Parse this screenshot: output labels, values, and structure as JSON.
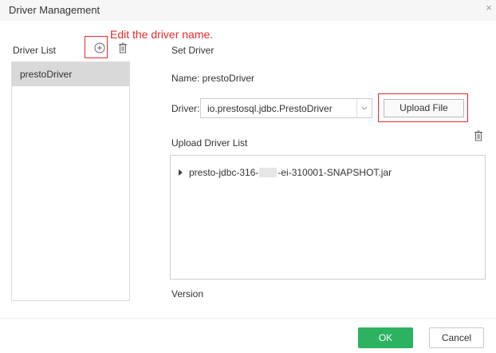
{
  "dialog": {
    "title": "Driver Management",
    "close_glyph": "×"
  },
  "annotation": {
    "text": "Edit the driver name.",
    "color": "#e32b2b"
  },
  "left_panel": {
    "heading": "Driver List",
    "add_icon": "plus-circle-icon",
    "delete_icon": "trash-icon",
    "items": [
      {
        "label": "prestoDriver",
        "selected": true
      }
    ]
  },
  "right_panel": {
    "heading": "Set Driver",
    "name_label": "Name: prestoDriver",
    "driver_label": "Driver:",
    "driver_value": "io.prestosql.jdbc.PrestoDriver",
    "upload_button": "Upload File",
    "upload_list_label": "Upload Driver List",
    "upload_list_delete_icon": "trash-icon",
    "files": [
      {
        "prefix": "presto-jdbc-316-",
        "suffix": "-ei-310001-SNAPSHOT.jar"
      }
    ],
    "version_label": "Version"
  },
  "footer": {
    "ok_label": "OK",
    "cancel_label": "Cancel",
    "ok_color": "#2db360"
  }
}
